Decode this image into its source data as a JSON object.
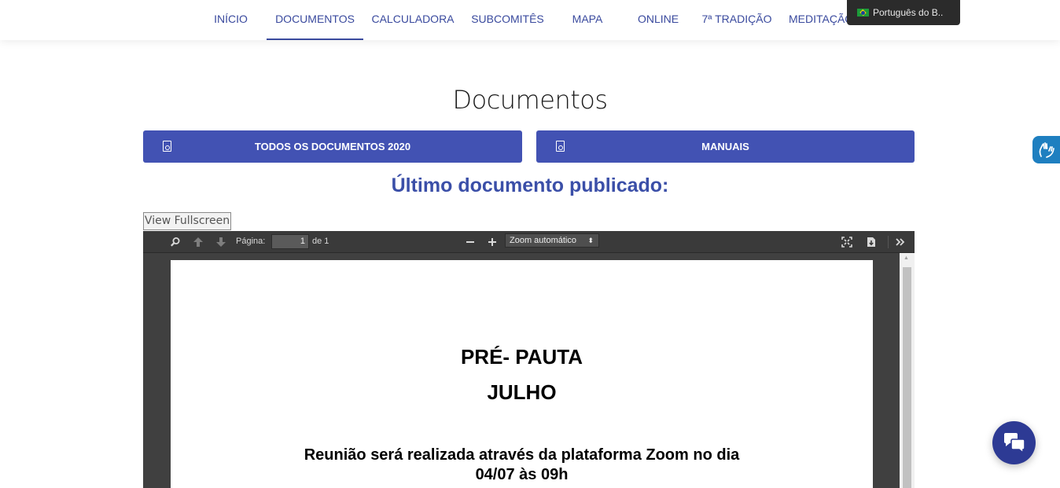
{
  "nav": {
    "items": [
      {
        "label": "INÍCIO"
      },
      {
        "label": "DOCUMENTOS"
      },
      {
        "label": "CALCULADORA"
      },
      {
        "label": "SUBCOMITÊS"
      },
      {
        "label": "MAPA"
      },
      {
        "label": "ONLINE"
      },
      {
        "label": "7ª TRADIÇÃO"
      },
      {
        "label": "MEDITAÇÃO"
      }
    ],
    "active_item": "DOCUMENTOS"
  },
  "language": {
    "label": "Português do B..",
    "flag_icon": "brazil-flag-icon"
  },
  "page": {
    "title": "Documentos",
    "buttons": {
      "all_docs": "TODOS OS DOCUMENTOS 2020",
      "manuals": "MANUAIS"
    },
    "subtitle": "Último documento publicado:",
    "fullscreen_label": "View Fullscreen"
  },
  "pdf_viewer": {
    "page_label": "Página:",
    "page_value": "1",
    "page_total": "de 1",
    "zoom_label": "Zoom automático",
    "document": {
      "heading1": "PRÉ- PAUTA",
      "heading2": "JULHO",
      "line1": "Reunião será realizada através da plataforma Zoom no dia",
      "line2": "04/07 às 09h"
    }
  },
  "colors": {
    "accent": "#4252b3",
    "nav_text": "#3a4a9e",
    "viewer_bg": "#404040",
    "chat_button": "#2d3a94",
    "a11y_button": "#1e7fc0"
  }
}
